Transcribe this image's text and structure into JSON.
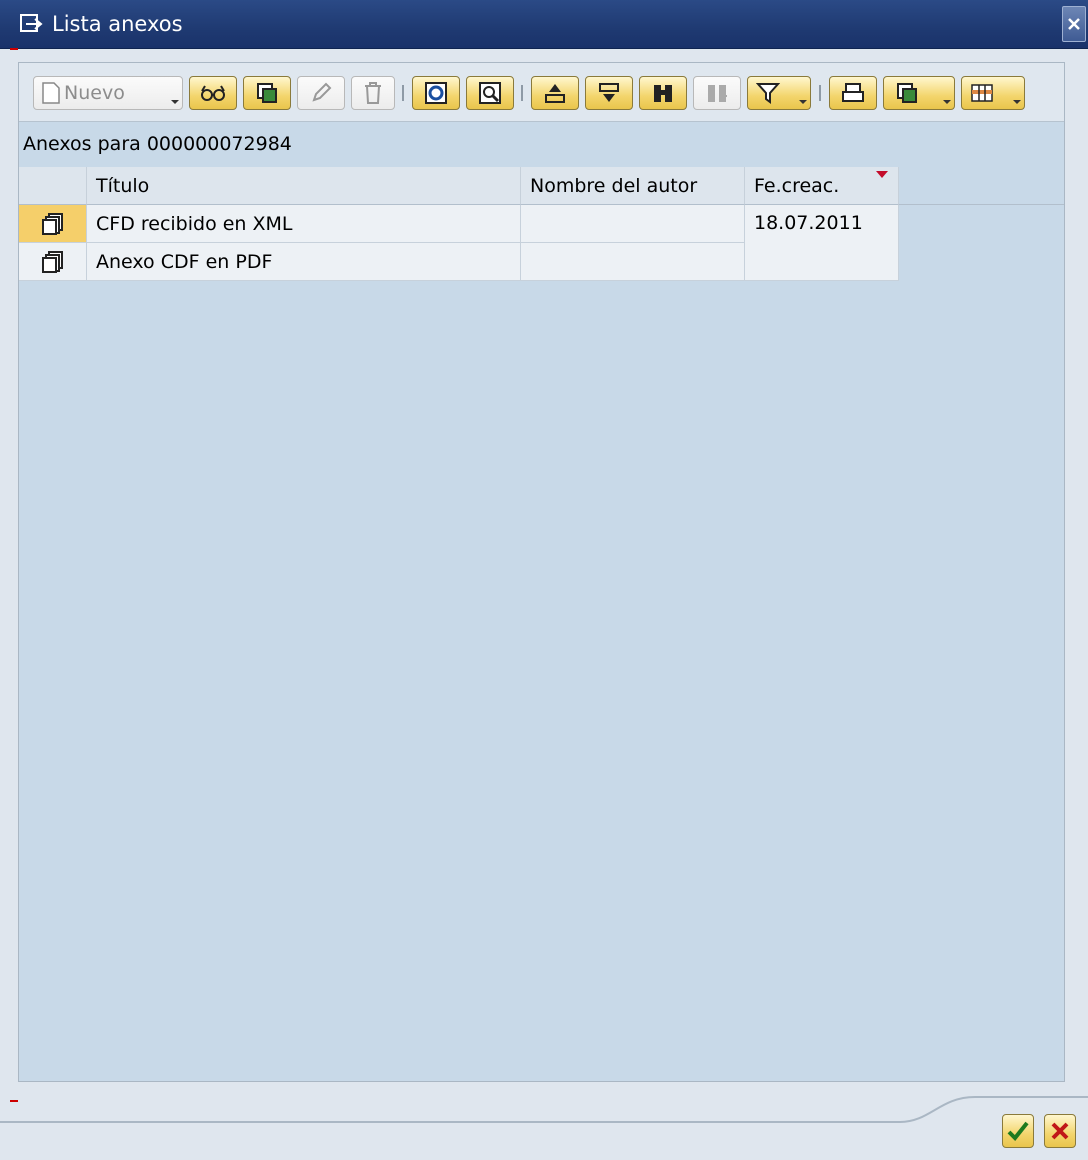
{
  "window": {
    "title": "Lista anexos"
  },
  "toolbar": {
    "new_label": "Nuevo",
    "buttons": [
      "display-icon",
      "copy-icon",
      "edit-icon",
      "delete-icon",
      "refresh-icon",
      "zoom-icon",
      "ascending-icon",
      "descending-icon",
      "find-icon",
      "find-next-icon",
      "filter-icon",
      "print-icon",
      "export-icon",
      "layout-icon"
    ]
  },
  "subtitle": "Anexos para 000000072984",
  "table": {
    "columns": [
      "Título",
      "Nombre del autor",
      "Fe.creac."
    ],
    "rows": [
      {
        "title": "CFD recibido en XML",
        "author": "",
        "date": "18.07.2011"
      },
      {
        "title": "Anexo CDF en PDF",
        "author": "",
        "date": ""
      }
    ]
  },
  "colors": {
    "titlebar": "#1f3a72",
    "panel": "#c8d9e8",
    "button": "#f3d56c",
    "accent_red": "#c30c2b"
  }
}
